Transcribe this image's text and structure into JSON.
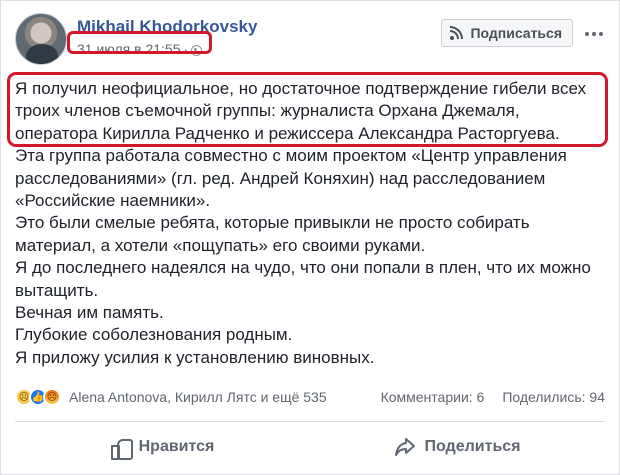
{
  "post": {
    "author": "Mikhail Khodorkovsky",
    "date": "31 июля в 21:55",
    "separator": "·",
    "subscribe_label": "Подписаться",
    "lines": [
      "Я получил неофициальное, но достаточное подтверждение гибели всех",
      "троих членов съемочной группы: журналиста Орхана Джемаля,",
      "оператора Кирилла Радченко и режиссера Александра Расторгуева.",
      "Эта группа работала совместно с моим проектом «Центр управления",
      "расследованиями» (гл. ред. Андрей Коняхин) над расследованием",
      "«Российские наемники».",
      "Это были смелые ребята, которые привыкли не просто собирать",
      "материал, а хотели «пощупать» его своими руками.",
      "Я до последнего надеялся на чудо, что они попали в плен, что их можно",
      "вытащить.",
      "Вечная им память.",
      "Глубокие соболезнования родным.",
      "Я приложу усилия к установлению виновных."
    ]
  },
  "reactions": {
    "icons": [
      "sad-reaction",
      "like-reaction",
      "angry-reaction"
    ],
    "names": "Alena Antonova, Кирилл Лятс и ещё 535",
    "comments": "Комментарии: 6",
    "shares": "Поделились: 94"
  },
  "actions": {
    "like_label": "Нравится",
    "share_label": "Поделиться"
  },
  "colors": {
    "author": "#385898",
    "highlight": "#d0182a",
    "like_blue": "#1877f2"
  }
}
